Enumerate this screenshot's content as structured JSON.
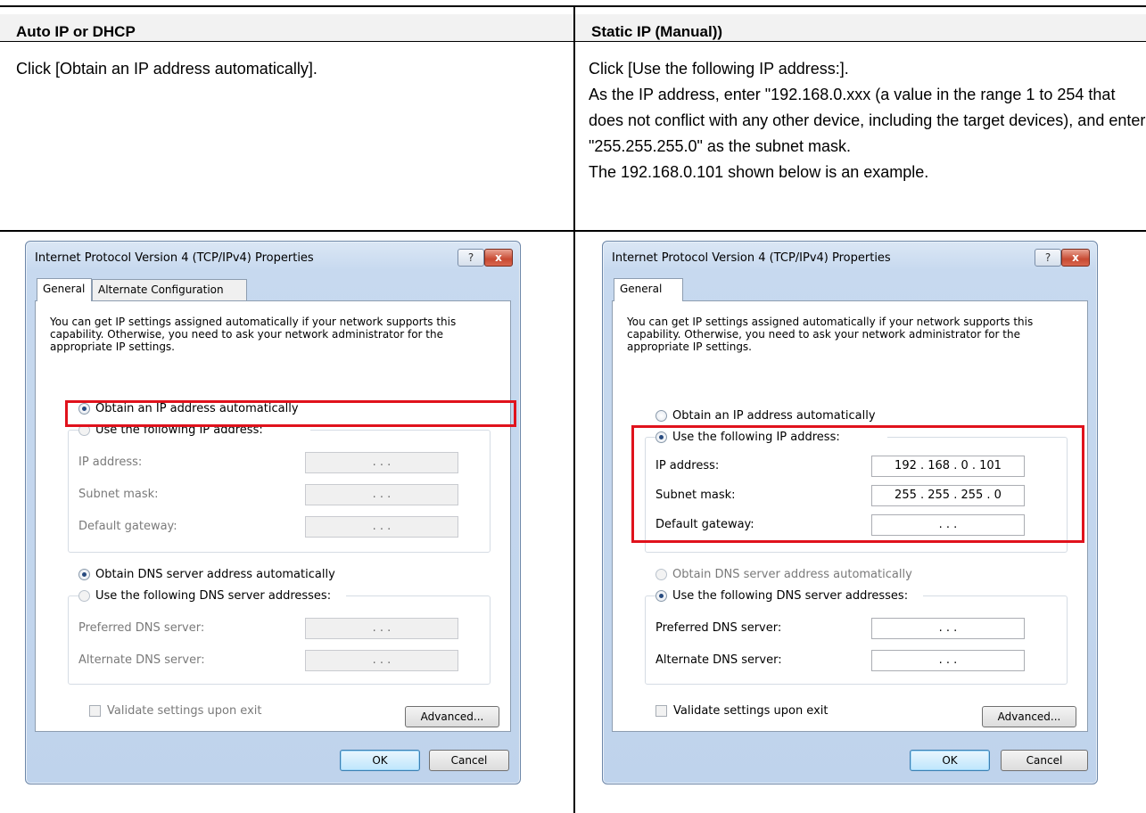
{
  "headers": {
    "left": "Auto IP or DHCP",
    "right": "Static IP (Manual))"
  },
  "descriptions": {
    "left": [
      "Click [Obtain an IP address automatically]."
    ],
    "right": [
      "Click [Use the following IP address:].",
      "As the IP address, enter \"192.168.0.xxx (a value in the range 1 to 254 that does not conflict with any other device, including the target devices), and enter \"255.255.255.0\" as the subnet mask.",
      "The 192.168.0.101 shown below is an example."
    ]
  },
  "dialog_common": {
    "title": "Internet Protocol Version 4 (TCP/IPv4) Properties",
    "help_glyph": "?",
    "close_glyph": "x",
    "intro": "You can get IP settings assigned automatically if your network supports this capability. Otherwise, you need to ask your network administrator for the appropriate IP settings.",
    "obtain_ip": "Obtain an IP address automatically",
    "use_ip": "Use the following IP address:",
    "ip_label": "IP address:",
    "subnet_label": "Subnet mask:",
    "gateway_label": "Default gateway:",
    "obtain_dns": "Obtain DNS server address automatically",
    "use_dns": "Use the following DNS server addresses:",
    "preferred_dns_label": "Preferred DNS server:",
    "alternate_dns_label": "Alternate DNS server:",
    "validate_label": "Validate settings upon exit",
    "advanced": "Advanced...",
    "ok": "OK",
    "cancel": "Cancel"
  },
  "dialog_left": {
    "tabs": [
      "General",
      "Alternate Configuration"
    ],
    "obtain_ip_selected": true,
    "obtain_dns_selected": true,
    "ip_value": " .   .   . ",
    "subnet_value": " .   .   . ",
    "gateway_value": " .   .   . ",
    "preferred_dns_value": " .   .   . ",
    "alternate_dns_value": " .   .   . "
  },
  "dialog_right": {
    "tabs": [
      "General"
    ],
    "use_ip_selected": true,
    "use_dns_selected": true,
    "ip_value": "192 . 168 .  0  . 101",
    "subnet_value": "255 . 255 . 255 .  0",
    "gateway_value": " .   .   . ",
    "preferred_dns_value": " .   .   . ",
    "alternate_dns_value": " .   .   . "
  },
  "colors": {
    "highlight": "#e0121c",
    "header_bg": "#f2f2f2"
  }
}
